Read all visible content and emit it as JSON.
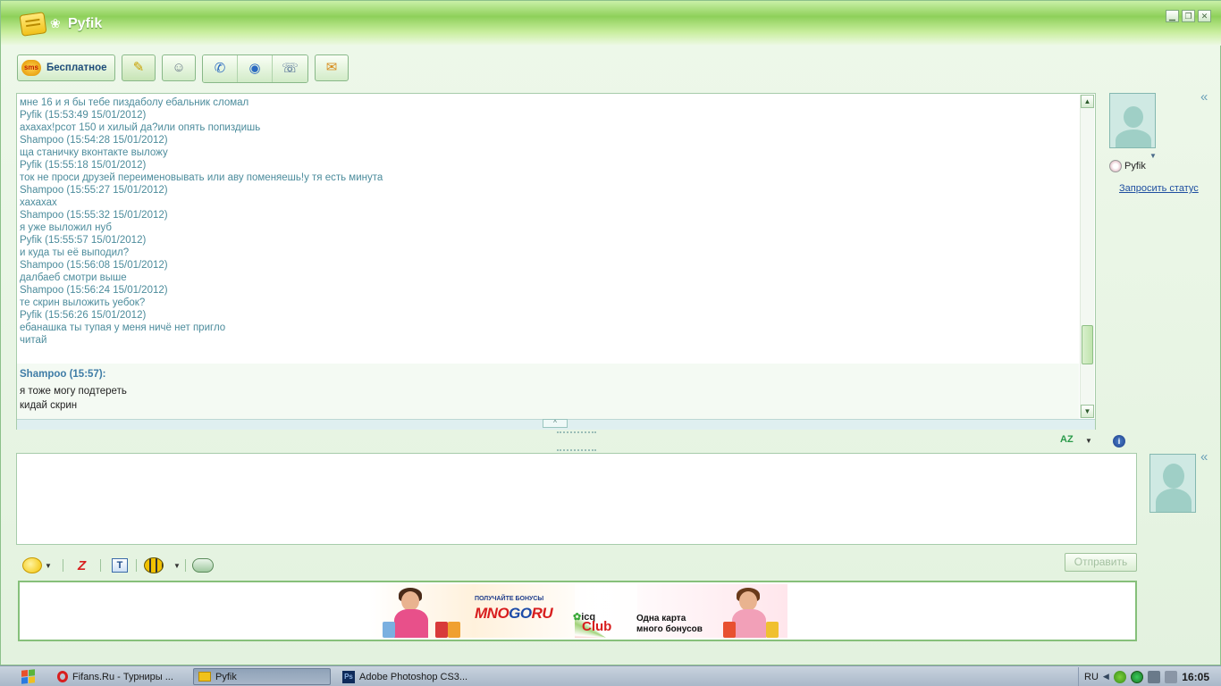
{
  "window": {
    "title": "Pyfik",
    "controls": [
      "minimize",
      "restore",
      "close"
    ]
  },
  "toolbar": {
    "sms_badge": "sms",
    "sms_label": "Бесплатное",
    "buttons": [
      "notes-icon",
      "contact-info-icon",
      "phone-icon",
      "video-call-icon",
      "fax-icon",
      "file-transfer-icon"
    ]
  },
  "history": {
    "lines": [
      "мне 16 и я бы тебе пиздаболу ебальник сломал",
      "Pyfik (15:53:49 15/01/2012)",
      "ахахах!рсот 150 и хилый да?или опять попиздишь",
      "Shampoo (15:54:28 15/01/2012)",
      "ща станичку вконтакте выложу",
      "Pyfik (15:55:18 15/01/2012)",
      "ток не проси друзей переименовывать или аву поменяешь!у тя есть минута",
      "Shampoo (15:55:27 15/01/2012)",
      "хахахах",
      "Shampoo (15:55:32 15/01/2012)",
      "я уже выложил нуб",
      "Pyfik (15:55:57 15/01/2012)",
      "и куда ты её выподил?",
      "Shampoo (15:56:08 15/01/2012)",
      "далбаеб смотри выше",
      "Shampoo (15:56:24 15/01/2012)",
      "те скрин выложить уебок?",
      "Pyfik (15:56:26 15/01/2012)",
      "ебанашка ты тупая у меня ничё нет пригло",
      "читай"
    ],
    "last_message": {
      "header": "Shampoo (15:57):",
      "lines": [
        "я тоже могу подтереть",
        "кидай скрин"
      ]
    }
  },
  "contact": {
    "name": "Pyfik",
    "status_link": "Запросить статус"
  },
  "input": {
    "spellcheck_label": "AZ",
    "info_label": "i",
    "value": ""
  },
  "bottom_toolbar": {
    "zoom_label": "Z",
    "text_label": "T"
  },
  "send_label": "Отправить",
  "ad": {
    "top_text": "ПОЛУЧАЙТЕ БОНУСЫ",
    "logo_left": "MNO",
    "logo_mid": "GO",
    "logo_right": "RU",
    "icq": "icq",
    "club": "Club",
    "slogan_1": "Одна карта",
    "slogan_2": "много бонусов"
  },
  "taskbar": {
    "tasks": [
      {
        "label": "Fifans.Ru - Турниры ...",
        "icon": "opera-icon"
      },
      {
        "label": "Pyfik",
        "icon": "icq-icon"
      },
      {
        "label": "Adobe Photoshop CS3...",
        "icon": "photoshop-icon"
      }
    ],
    "lang": "RU",
    "time": "16:05"
  },
  "colors": {
    "titlebar_green": "#8ed05a",
    "history_text": "#4c8c9c",
    "link_blue": "#1e4ea0",
    "taskbar": "#b9c5d3"
  }
}
